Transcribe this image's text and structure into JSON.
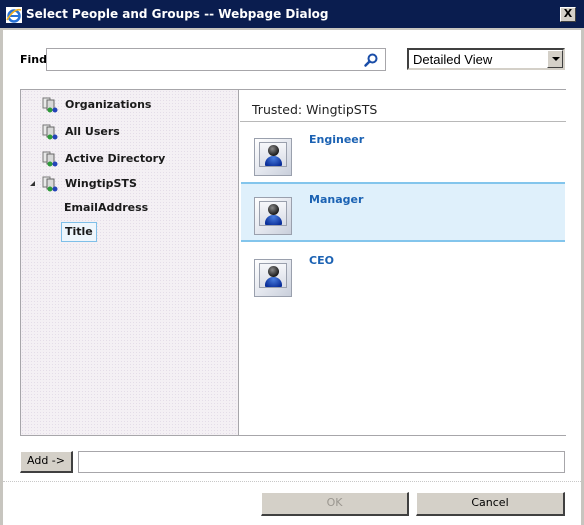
{
  "window": {
    "title": "Select People and Groups -- Webpage Dialog",
    "close_label": "X"
  },
  "find": {
    "label": "Find",
    "value": "",
    "placeholder": ""
  },
  "view_select": {
    "selected": "Detailed View"
  },
  "tree": {
    "items": [
      {
        "label": "Organizations",
        "icon": "directory-icon"
      },
      {
        "label": "All Users",
        "icon": "directory-icon"
      },
      {
        "label": "Active Directory",
        "icon": "directory-icon"
      },
      {
        "label": "WingtipSTS",
        "icon": "directory-icon",
        "expanded": true
      }
    ],
    "children": [
      {
        "label": "EmailAddress"
      },
      {
        "label": "Title",
        "selected": true
      }
    ]
  },
  "results": {
    "header": "Trusted: WingtipSTS",
    "items": [
      {
        "name": "Engineer",
        "icon": "user-icon",
        "selected": false
      },
      {
        "name": "Manager",
        "icon": "user-icon",
        "selected": true
      },
      {
        "name": "CEO",
        "icon": "user-icon",
        "selected": false
      }
    ]
  },
  "add": {
    "button_label": "Add ->",
    "value": ""
  },
  "footer": {
    "ok_label": "OK",
    "ok_disabled": true,
    "cancel_label": "Cancel"
  }
}
